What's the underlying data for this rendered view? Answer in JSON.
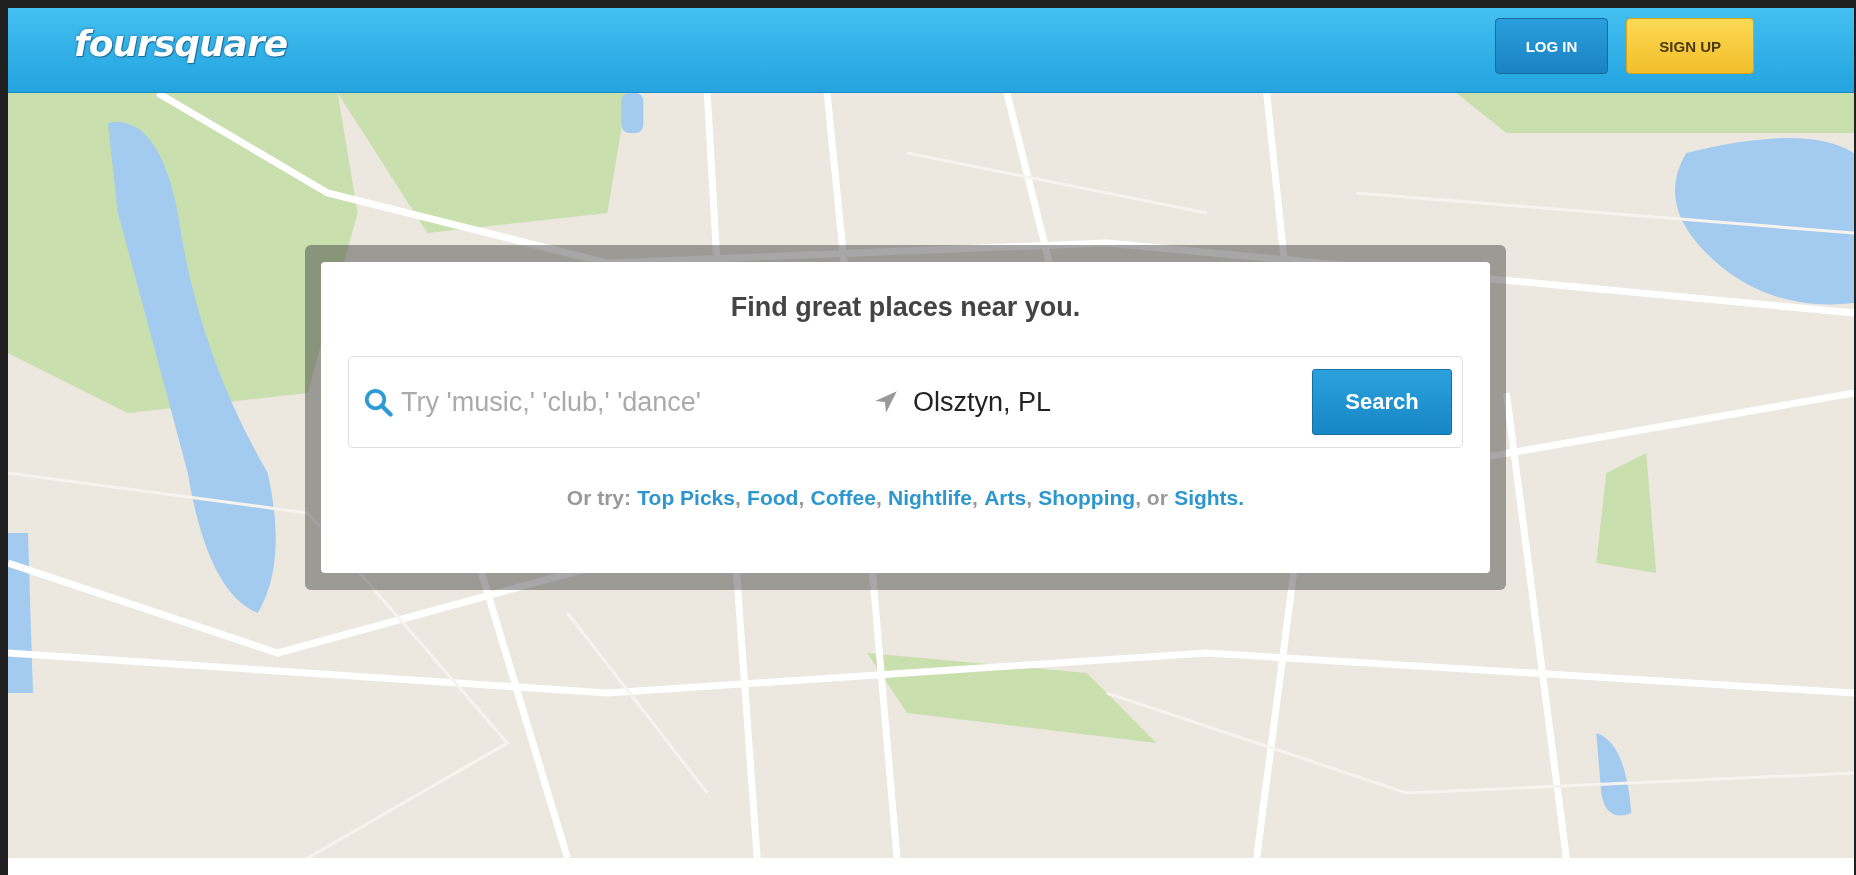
{
  "header": {
    "logo": "foursquare",
    "buttons": [
      {
        "label": "LOG IN",
        "kind": "login"
      },
      {
        "label": "SIGN UP",
        "kind": "signup"
      }
    ]
  },
  "search": {
    "title": "Find great places near you.",
    "query_placeholder": "Try 'music,' 'club,' 'dance'",
    "location": "Olsztyn, PL",
    "button": "Search",
    "suggestions": {
      "prefix": "Or try:",
      "links": [
        {
          "label": "Top Picks",
          "after": ","
        },
        {
          "label": "Food",
          "after": ","
        },
        {
          "label": "Coffee",
          "after": ","
        },
        {
          "label": "Nightlife",
          "after": ","
        },
        {
          "label": "Arts",
          "after": ","
        },
        {
          "label": "Shopping",
          "after": ", or"
        },
        {
          "label": "Sights."
        }
      ]
    }
  }
}
